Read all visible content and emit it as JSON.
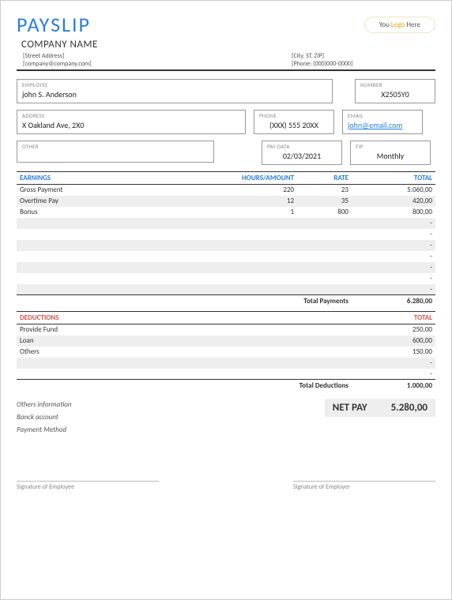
{
  "header": {
    "title": "PAYSLIP",
    "logo_pre": "You ",
    "logo_word": "Logo",
    "logo_post": " Here",
    "company": "COMPANY NAME",
    "street": "[Street Address]",
    "email": "[company@company.com]",
    "city": "[City, ST, ZIP]",
    "phone": "[Phone: (000)000-0000]"
  },
  "fields": {
    "employee_lbl": "EMPLOYEE",
    "employee": "john S. Anderson",
    "number_lbl": "NUMBER",
    "number": "X2505Y0",
    "address_lbl": "ADDRESS",
    "address": "X Oakland Ave, 2X0",
    "phone_lbl": "PHONE",
    "phone": "(XXX) 555 20XX",
    "email_lbl": "EMAIL",
    "email": "john@email.com",
    "other_lbl": "OTHER",
    "other": "",
    "paydata_lbl": "PAY DATA",
    "paydata": "02/03/2021",
    "tip_lbl": "TIP",
    "tip": "Monthly"
  },
  "earnings": {
    "headers": {
      "desc": "EARNINGS",
      "hours": "HOURS/AMOUNT",
      "rate": "RATE",
      "total": "TOTAL"
    },
    "rows": [
      {
        "desc": "Gross Payment",
        "hours": "220",
        "rate": "23",
        "total": "5.060,00"
      },
      {
        "desc": "Overtime Pay",
        "hours": "12",
        "rate": "35",
        "total": "420,00"
      },
      {
        "desc": "Bonus",
        "hours": "1",
        "rate": "800",
        "total": "800,00"
      },
      {
        "desc": "",
        "hours": "",
        "rate": "",
        "total": "-"
      },
      {
        "desc": "",
        "hours": "",
        "rate": "",
        "total": "-"
      },
      {
        "desc": "",
        "hours": "",
        "rate": "",
        "total": "-"
      },
      {
        "desc": "",
        "hours": "",
        "rate": "",
        "total": "-"
      },
      {
        "desc": "",
        "hours": "",
        "rate": "",
        "total": "-"
      },
      {
        "desc": "",
        "hours": "",
        "rate": "",
        "total": "-"
      },
      {
        "desc": "",
        "hours": "",
        "rate": "",
        "total": "-"
      }
    ],
    "total_lbl": "Total Payments",
    "total": "6.280,00"
  },
  "deductions": {
    "headers": {
      "desc": "DEDUCTIONS",
      "total": "TOTAL"
    },
    "rows": [
      {
        "desc": "Provide Fund",
        "total": "250,00"
      },
      {
        "desc": "Loan",
        "total": "600,00"
      },
      {
        "desc": "Others",
        "total": "150,00"
      },
      {
        "desc": "",
        "total": "-"
      },
      {
        "desc": "",
        "total": "-"
      }
    ],
    "total_lbl": "Total Deductions",
    "total": "1.000,00"
  },
  "footer": {
    "others_info": "Others information",
    "bank": "Banck account",
    "payment": "Payment Method",
    "netpay_lbl": "NET PAY",
    "netpay": "5.280,00",
    "sig_emp": "Signature of Employee",
    "sig_er": "Signature of Employer"
  }
}
